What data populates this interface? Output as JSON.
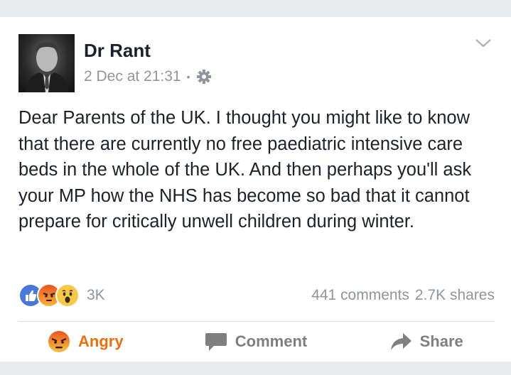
{
  "post": {
    "author": "Dr Rant",
    "timestamp": "2 Dec at 21:31",
    "separator": "•",
    "text": "Dear Parents of the UK. I thought you might like to know that there are currently no free paediatric intensive care beds in the whole of the UK. And then perhaps you'll ask your MP how the NHS has become so bad that it cannot prepare for critically unwell children during winter."
  },
  "stats": {
    "reaction_count": "3K",
    "comments": "441 comments",
    "shares": "2.7K shares"
  },
  "actions": {
    "angry_label": "Angry",
    "comment_label": "Comment",
    "share_label": "Share"
  },
  "colors": {
    "like_blue": "#4a78d9",
    "angry_orange": "#e9710f",
    "muted_gray": "#90949c",
    "text_dark": "#1d2129"
  },
  "icons": [
    "profile-photo",
    "gear-icon",
    "chevron-down-icon",
    "like-reaction-icon",
    "angry-reaction-icon",
    "wow-reaction-icon",
    "angry-face-icon",
    "comment-bubble-icon",
    "share-arrow-icon"
  ]
}
